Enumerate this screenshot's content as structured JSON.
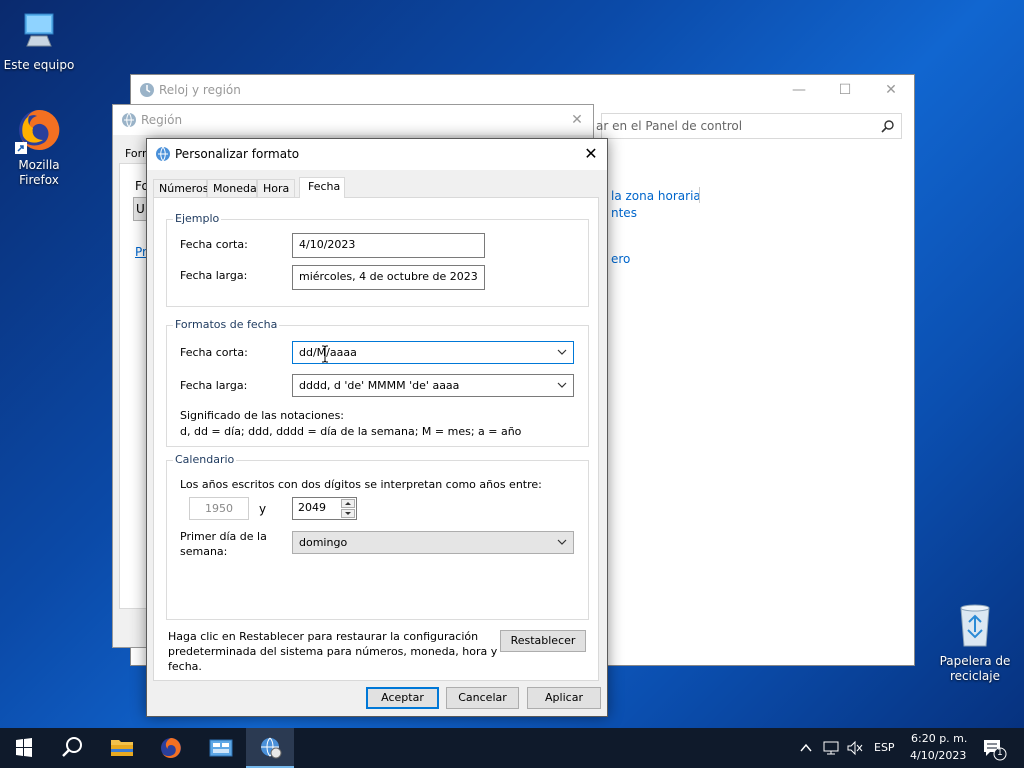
{
  "desktop": {
    "icons": [
      {
        "label": "Este equipo",
        "icon": "computer-icon"
      },
      {
        "label_line1": "Mozilla",
        "label_line2": "Firefox",
        "icon": "firefox-icon"
      },
      {
        "label_line1": "Papelera de",
        "label_line2": "reciclaje",
        "icon": "recycle-bin-icon"
      }
    ]
  },
  "back_window": {
    "title": "Reloj y región",
    "search_placeholder": "ar en el Panel de control",
    "links": [
      "la zona horaria",
      "ntes",
      "ero"
    ]
  },
  "region_window": {
    "title": "Región",
    "fragments": [
      "Form",
      "Fo",
      "U",
      "Pr"
    ]
  },
  "dialog": {
    "title": "Personalizar formato",
    "tabs": [
      "Números",
      "Moneda",
      "Hora",
      "Fecha"
    ],
    "active_tab": "Fecha",
    "example": {
      "title": "Ejemplo",
      "short_label": "Fecha corta:",
      "short_value": "4/10/2023",
      "long_label": "Fecha larga:",
      "long_value": "miércoles, 4 de octubre de 2023"
    },
    "formats": {
      "title": "Formatos de fecha",
      "short_label": "Fecha corta:",
      "short_value": "dd/M/aaaa",
      "long_label": "Fecha larga:",
      "long_value": "dddd, d 'de' MMMM 'de' aaaa",
      "notation_title": "Significado de las notaciones:",
      "notation_text": "d, dd = día;  ddd, dddd = día de la semana; M = mes; a = año"
    },
    "calendar": {
      "title": "Calendario",
      "two_digit_text": "Los años escritos con dos dígitos se interpretan como años entre:",
      "year_from": "1950",
      "and_label": "y",
      "year_to": "2049",
      "first_day_label_line1": "Primer día de la",
      "first_day_label_line2": "semana:",
      "first_day_value": "domingo"
    },
    "reset_text_line1": "Haga clic en Restablecer para restaurar la configuración",
    "reset_text_line2": "predeterminada del sistema para números, moneda, hora y",
    "reset_text_line3": "fecha.",
    "reset_button": "Restablecer",
    "ok_button": "Aceptar",
    "cancel_button": "Cancelar",
    "apply_button": "Aplicar"
  },
  "taskbar": {
    "language": "ESP",
    "time": "6:20 p. m.",
    "date": "4/10/2023",
    "notification_count": "1"
  },
  "colors": {
    "accent": "#0078d7",
    "link": "#0066cc",
    "taskbar": "#0f1a2b"
  }
}
